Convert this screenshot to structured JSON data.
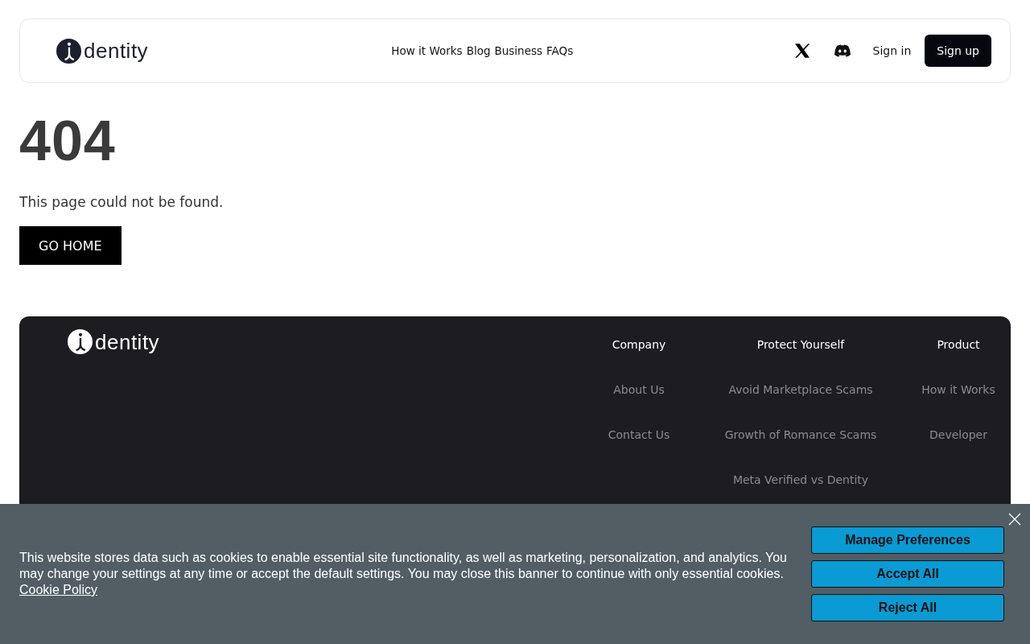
{
  "header": {
    "logo_text": "dentity",
    "nav": [
      "How it Works",
      "Blog",
      "Business",
      "FAQs"
    ],
    "sign_in": "Sign in",
    "sign_up": "Sign up"
  },
  "error": {
    "code": "404",
    "message": "This page could not be found.",
    "button": "GO HOME"
  },
  "footer": {
    "logo_text": "dentity",
    "columns": [
      {
        "title": "Company",
        "links": [
          "About Us",
          "Contact Us"
        ]
      },
      {
        "title": "Protect Yourself",
        "links": [
          "Avoid Marketplace Scams",
          "Growth of Romance Scams",
          "Meta Verified vs Dentity"
        ]
      },
      {
        "title": "Product",
        "links": [
          "How it Works",
          "Developer"
        ]
      }
    ]
  },
  "cookie_banner": {
    "text": "This website stores data such as cookies to enable essential site functionality, as well as marketing, personalization, and analytics. You may change your settings at any time or accept the default settings. You may close this banner to continue with only essential cookies.",
    "link": "Cookie Policy",
    "buttons": [
      "Manage Preferences",
      "Accept All",
      "Reject All"
    ]
  }
}
